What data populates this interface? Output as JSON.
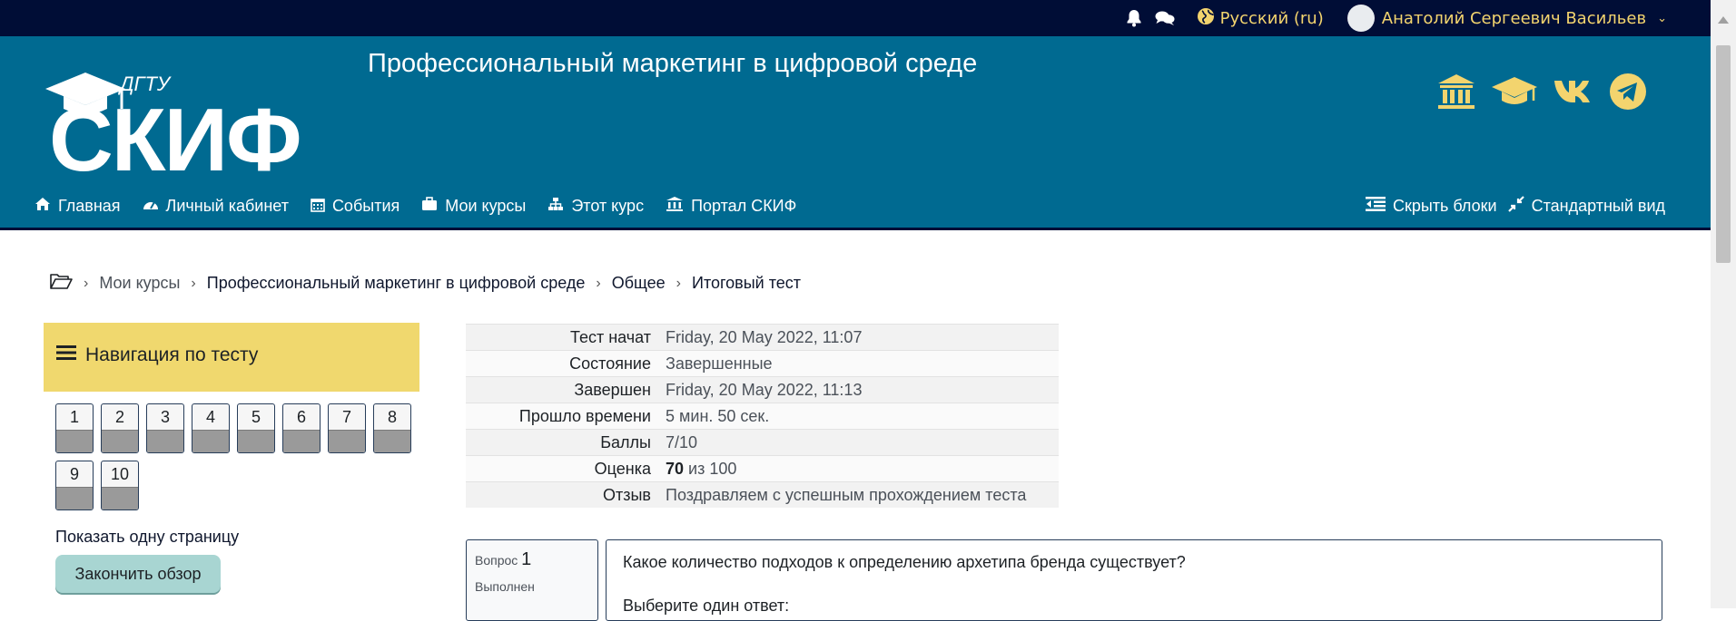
{
  "topbar": {
    "language": "Русский (ru)",
    "user_name": "Анатолий Сергеевич Васильев"
  },
  "header": {
    "logo_small": "ДГТУ",
    "logo_main": "СКИФ",
    "course_title": "Профессиональный маркетинг в цифровой среде"
  },
  "nav": {
    "home": "Главная",
    "dashboard": "Личный кабинет",
    "events": "События",
    "my_courses": "Мои курсы",
    "this_course": "Этот курс",
    "portal": "Портал СКИФ",
    "hide_blocks": "Скрыть блоки",
    "standard_view": "Стандартный вид"
  },
  "breadcrumb": {
    "my_courses": "Мои курсы",
    "course": "Профессиональный маркетинг в цифровой среде",
    "section": "Общее",
    "quiz": "Итоговый тест"
  },
  "quiz_nav": {
    "title": "Навигация по тесту",
    "questions": [
      "1",
      "2",
      "3",
      "4",
      "5",
      "6",
      "7",
      "8",
      "9",
      "10"
    ],
    "show_one_page": "Показать одну страницу",
    "finish_review": "Закончить обзор"
  },
  "summary": {
    "rows": [
      {
        "label": "Тест начат",
        "value": "Friday, 20 May 2022, 11:07"
      },
      {
        "label": "Состояние",
        "value": "Завершенные"
      },
      {
        "label": "Завершен",
        "value": "Friday, 20 May 2022, 11:13"
      },
      {
        "label": "Прошло времени",
        "value": "5 мин. 50 сек."
      },
      {
        "label": "Баллы",
        "value": "7/10"
      },
      {
        "label": "Оценка",
        "value_bold": "70",
        "value_rest": " из 100"
      },
      {
        "label": "Отзыв",
        "value": "Поздравляем с успешным прохождением теста"
      }
    ]
  },
  "question": {
    "label": "Вопрос",
    "number": "1",
    "state": "Выполнен",
    "text": "Какое количество подходов к определению архетипа бренда существует?",
    "prompt": "Выберите один ответ:"
  },
  "colors": {
    "topbar": "#000d36",
    "header": "#006a91",
    "accent_gold": "#f3d46e",
    "nav_block": "#f0d86e",
    "finish_button": "#a8d5d2"
  }
}
